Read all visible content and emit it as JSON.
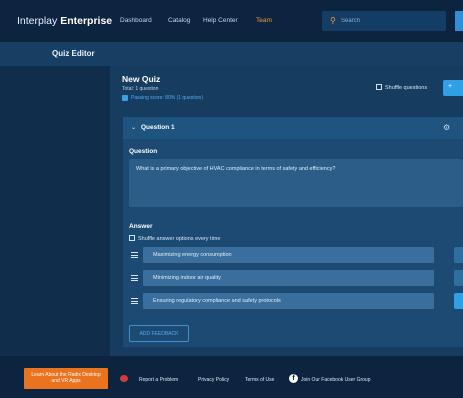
{
  "header": {
    "brand_plain": "Interplay",
    "brand_bold": "Enterprise",
    "nav": [
      "Dashboard",
      "Catalog",
      "Help Center",
      "Team"
    ],
    "search_placeholder": "Search"
  },
  "editor": {
    "title": "Quiz Editor"
  },
  "quiz": {
    "title": "New Quiz",
    "total": "Total: 1 question",
    "passing": "Passing score: 80% (1 question)",
    "shuffle_questions": "Shuffle questions",
    "add_label": "+"
  },
  "question_card": {
    "heading": "Question 1",
    "question_label": "Question",
    "question_text": "What is a primary objective of HVAC compliance in terms of safety and efficiency?",
    "answer_label": "Answer",
    "shuffle_answers": "Shuffle answer options every time",
    "answers": [
      "Maximizing energy consumption",
      "Minimizing indoor air quality",
      "Ensuring regulatory compliance and safety protocols"
    ],
    "selected_answer_index": 2,
    "add_feedback": "ADD FEEDBACK"
  },
  "footer": {
    "learn_button": "Learn About the Radix Desktop and VR Apps",
    "links": [
      "Report a Problem",
      "Privacy Policy",
      "Terms of Use",
      "Join Our Facebook User Group"
    ]
  },
  "colors": {
    "accent_orange": "#e9731f",
    "accent_blue": "#2f9fe6",
    "background": "#0f2f4e"
  }
}
